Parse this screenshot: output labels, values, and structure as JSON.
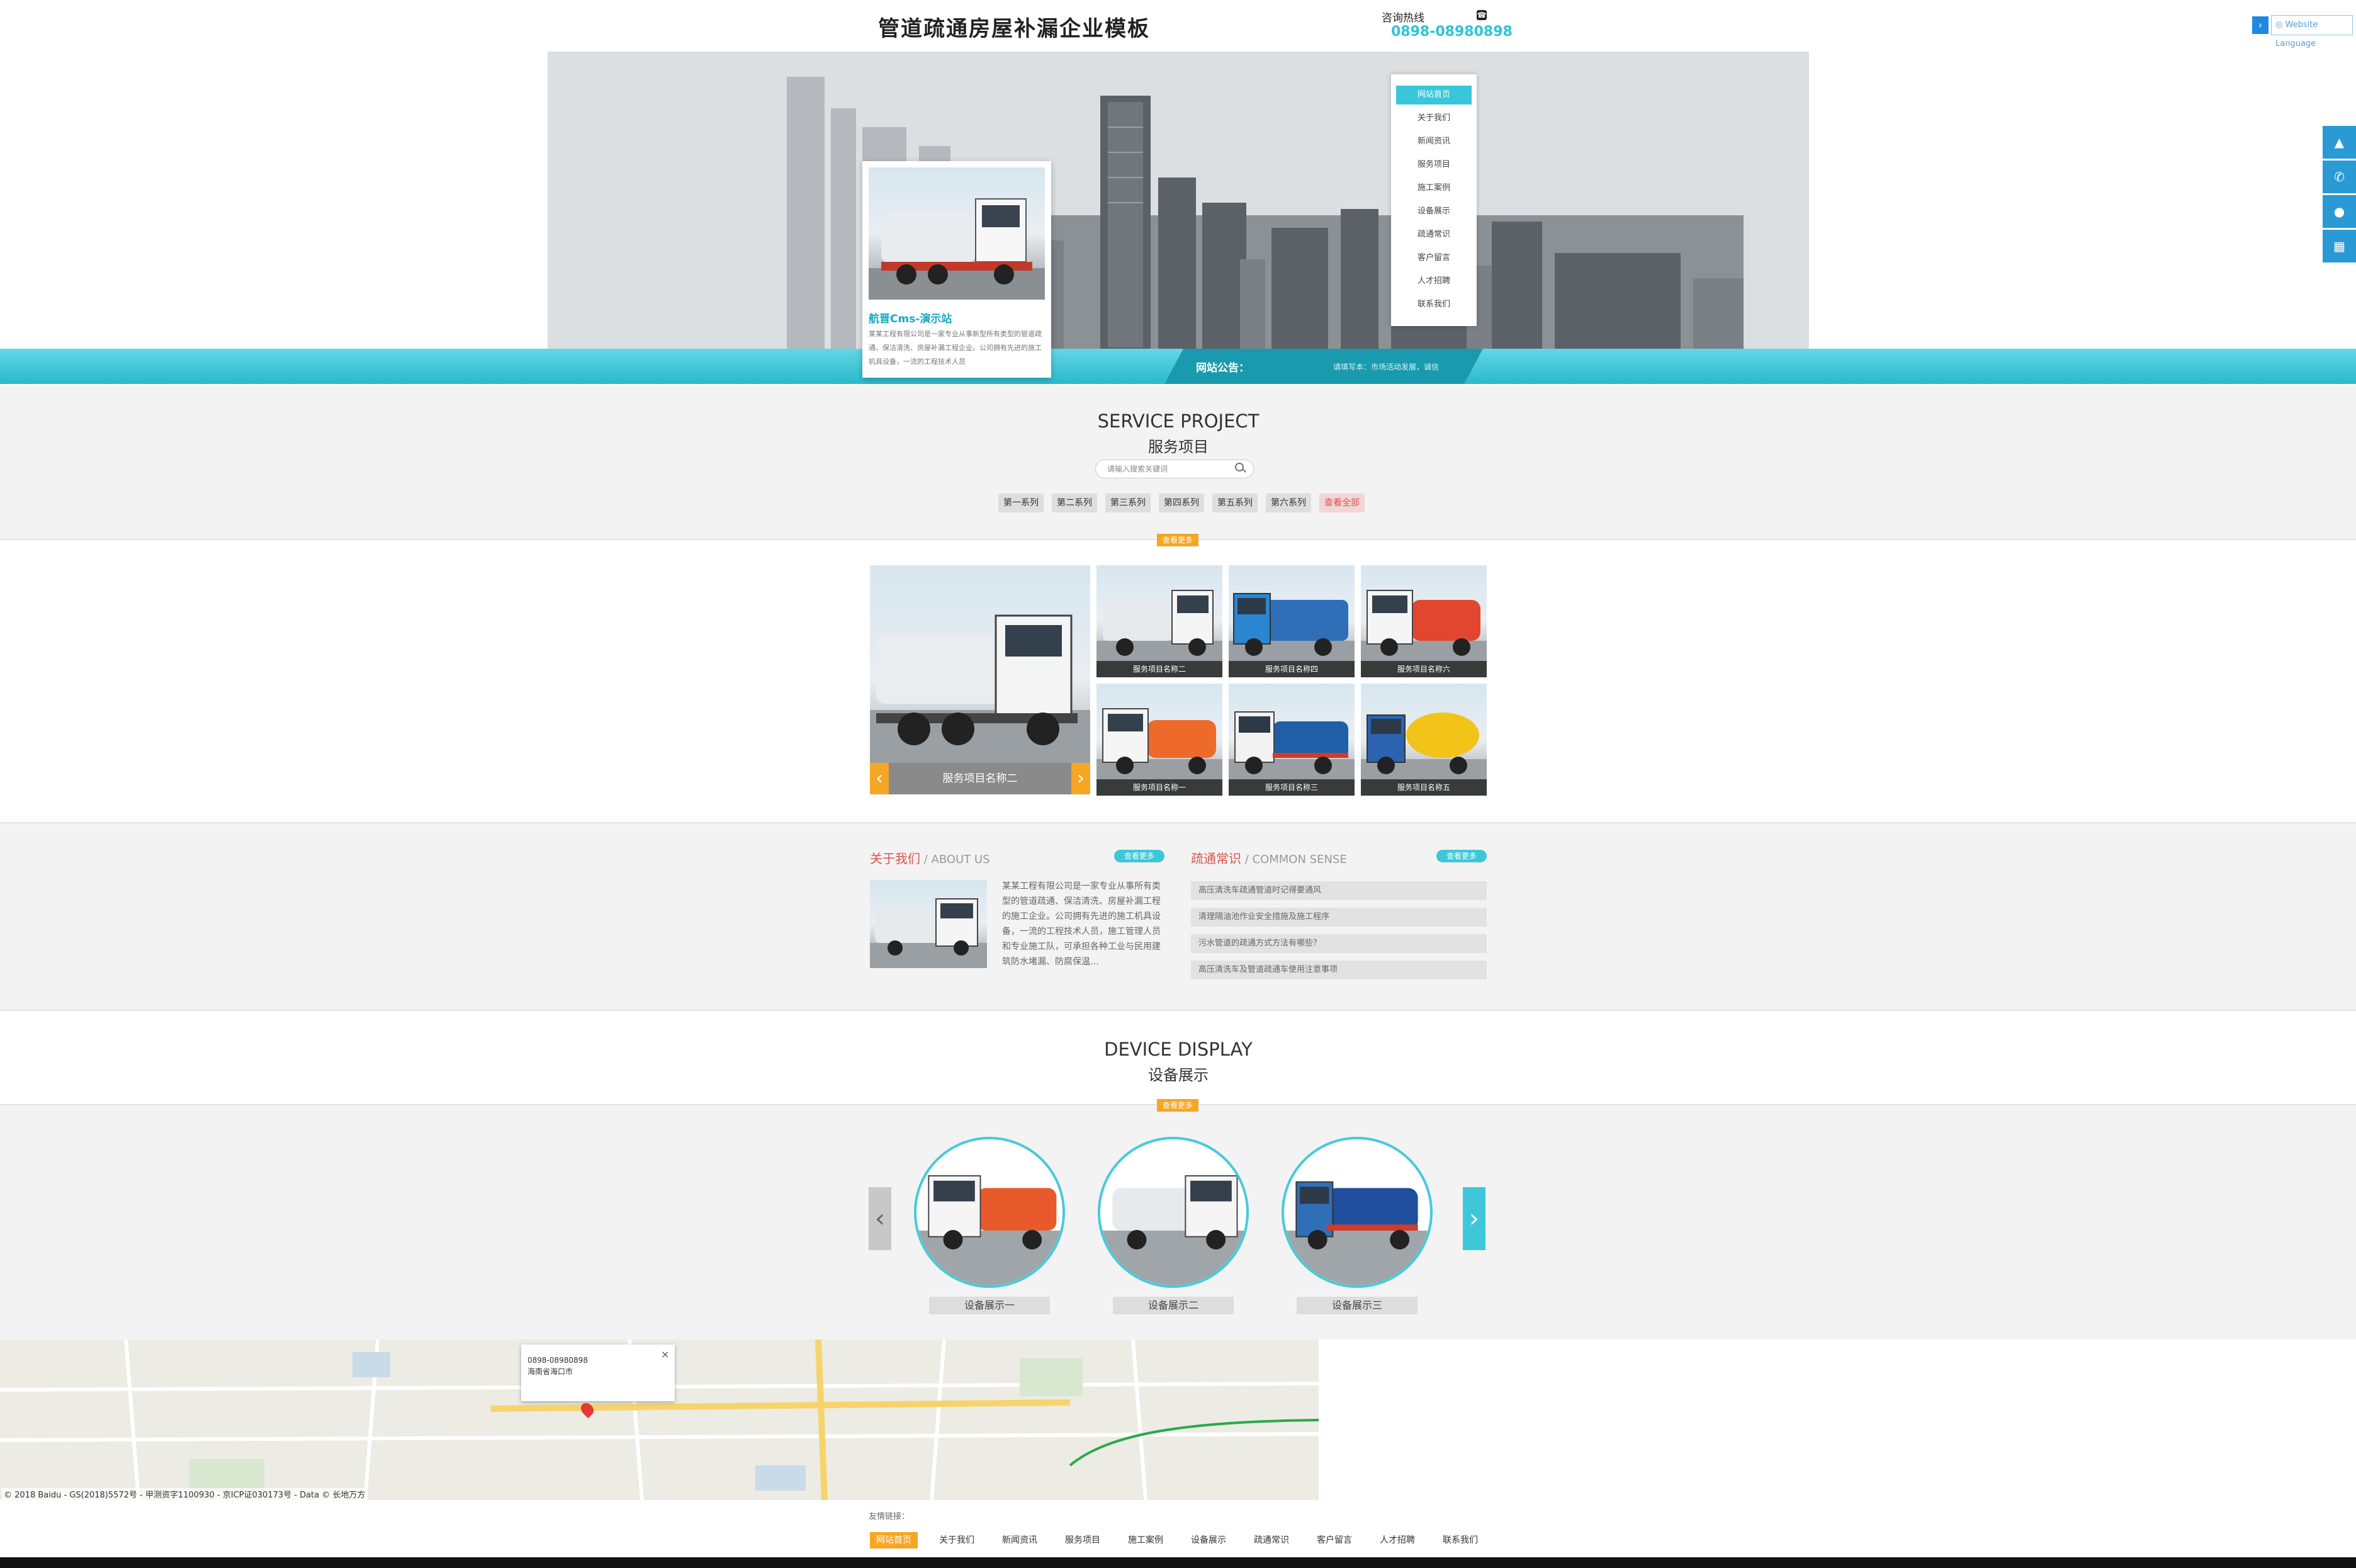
{
  "header": {
    "site_title": "管道疏通房屋补漏企业模板",
    "hotline_label": "咨询热线",
    "hotline_number": "0898-08980898",
    "language_button": "Website Language"
  },
  "nav": {
    "items": [
      "网站首页",
      "关于我们",
      "新闻资讯",
      "服务项目",
      "施工案例",
      "设备展示",
      "疏通常识",
      "客户留言",
      "人才招聘",
      "联系我们"
    ],
    "active_index": 0
  },
  "banner_feature": {
    "title": "航晋Cms-演示站",
    "description": "某某工程有限公司是一家专业从事新型所有类型的管道疏通、保洁清洗、房屋补漏工程企业。公司拥有先进的施工机具设备，一流的工程技术人员"
  },
  "notice": {
    "label": "网站公告：",
    "text": "请填写本：市场活动发展，诚信"
  },
  "service": {
    "title_en": "SERVICE PROJECT",
    "title_cn": "服务项目",
    "search_placeholder": "请输入搜索关键词",
    "tabs": [
      "第一系列",
      "第二系列",
      "第三系列",
      "第四系列",
      "第五系列",
      "第六系列",
      "查看全部"
    ],
    "more_label": "查看更多",
    "featured_caption": "服务项目名称二",
    "thumbs": [
      {
        "caption": "服务项目名称二"
      },
      {
        "caption": "服务项目名称四"
      },
      {
        "caption": "服务项目名称六"
      },
      {
        "caption": "服务项目名称一"
      },
      {
        "caption": "服务项目名称三"
      },
      {
        "caption": "服务项目名称五"
      }
    ]
  },
  "about": {
    "title_cn": "关于我们",
    "title_en": " / ABOUT US",
    "more_label": "查看更多",
    "text": "某某工程有限公司是一家专业从事所有类型的管道疏通、保洁清洗、房屋补漏工程的施工企业。公司拥有先进的施工机具设备，一流的工程技术人员，施工管理人员和专业施工队，可承担各种工业与民用建筑防水堵漏、防腐保温…"
  },
  "common_sense": {
    "title_cn": "疏通常识",
    "title_en": " / COMMON SENSE",
    "more_label": "查看更多",
    "items": [
      "高压清洗车疏通管道时记得要通风",
      "清理隔油池作业安全措施及施工程序",
      "污水管道的疏通方式方法有哪些？",
      "高压清洗车及管道疏通车使用注意事项"
    ]
  },
  "device": {
    "title_en": "DEVICE DISPLAY",
    "title_cn": "设备展示",
    "more_label": "查看更多",
    "items": [
      {
        "caption": "设备展示一"
      },
      {
        "caption": "设备展示二"
      },
      {
        "caption": "设备展示三"
      }
    ]
  },
  "map": {
    "popup_phone": "0898-08980898",
    "popup_address": "海南省海口市",
    "copyright": "© 2018 Baidu - GS(2018)5572号 - 甲测资字1100930 - 京ICP证030173号 - Data © 长地万方"
  },
  "footer": {
    "friend_links_label": "友情链接：",
    "nav": [
      "网站首页",
      "关于我们",
      "新闻资讯",
      "服务项目",
      "施工案例",
      "设备展示",
      "疏通常识",
      "客户留言",
      "人才招聘",
      "联系我们"
    ]
  },
  "colors": {
    "accent_teal": "#3ec7d8",
    "accent_orange": "#f5a623",
    "accent_red": "#d9534f",
    "sidebar_blue": "#2a9ad5"
  },
  "icons": {
    "side_tools": [
      "rocket-icon",
      "phone-icon",
      "qq-icon",
      "qrcode-icon"
    ]
  }
}
